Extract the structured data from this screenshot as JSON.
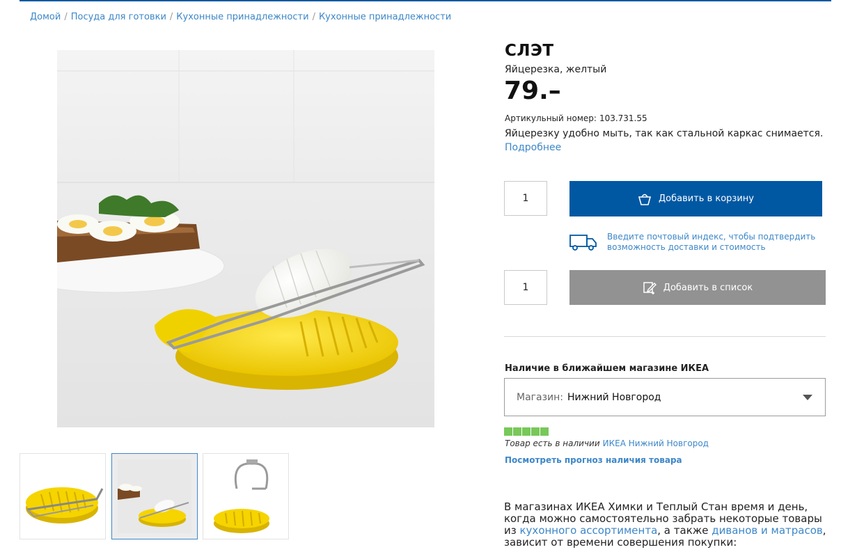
{
  "breadcrumb": [
    "Домой",
    "Посуда для готовки",
    "Кухонные принадлежности",
    "Кухонные принадлежности"
  ],
  "product": {
    "name": "СЛЭТ",
    "subtitle": "Яйцерезка, желтый",
    "price": "79.–",
    "article_label": "Артикульный номер:",
    "article_number": "103.731.55",
    "description": "Яйцерезку удобно мыть, так как стальной каркас снимается.",
    "more_link": "Подробнее"
  },
  "cart": {
    "quantity": "1",
    "add_label": "Добавить в корзину",
    "icon": "basket-icon"
  },
  "delivery": {
    "text": "Введите почтовый индекс, чтобы подтвердить возможность доставки и стоимость",
    "icon": "truck-icon"
  },
  "list": {
    "quantity": "1",
    "add_label": "Добавить в список",
    "icon": "pencil-list-icon"
  },
  "availability": {
    "heading": "Наличие в ближайшем магазине ИКЕА",
    "store_label": "Магазин:",
    "store_value": "Нижний Новгород",
    "stock_text": "Товар есть в наличии",
    "stock_store": "ИКЕА Нижний Новгород",
    "stock_level": 5,
    "stock_max": 5,
    "forecast_link": "Посмотреть прогноз наличия товара"
  },
  "info_paragraph": {
    "part1": "В магазинах ИКЕА Химки и Теплый Стан время и день, когда можно самостоятельно забрать некоторые товары из ",
    "link1": "кухонного ассортимента",
    "part2": ", а также ",
    "link2": "диванов и матрасов",
    "part3": ", зависит от времени совершения покупки:"
  },
  "colors": {
    "accent": "#0058a3",
    "link": "#3d87c8",
    "stock_green": "#78c85a",
    "list_button": "#929292",
    "product_yellow": "#f2d500"
  }
}
